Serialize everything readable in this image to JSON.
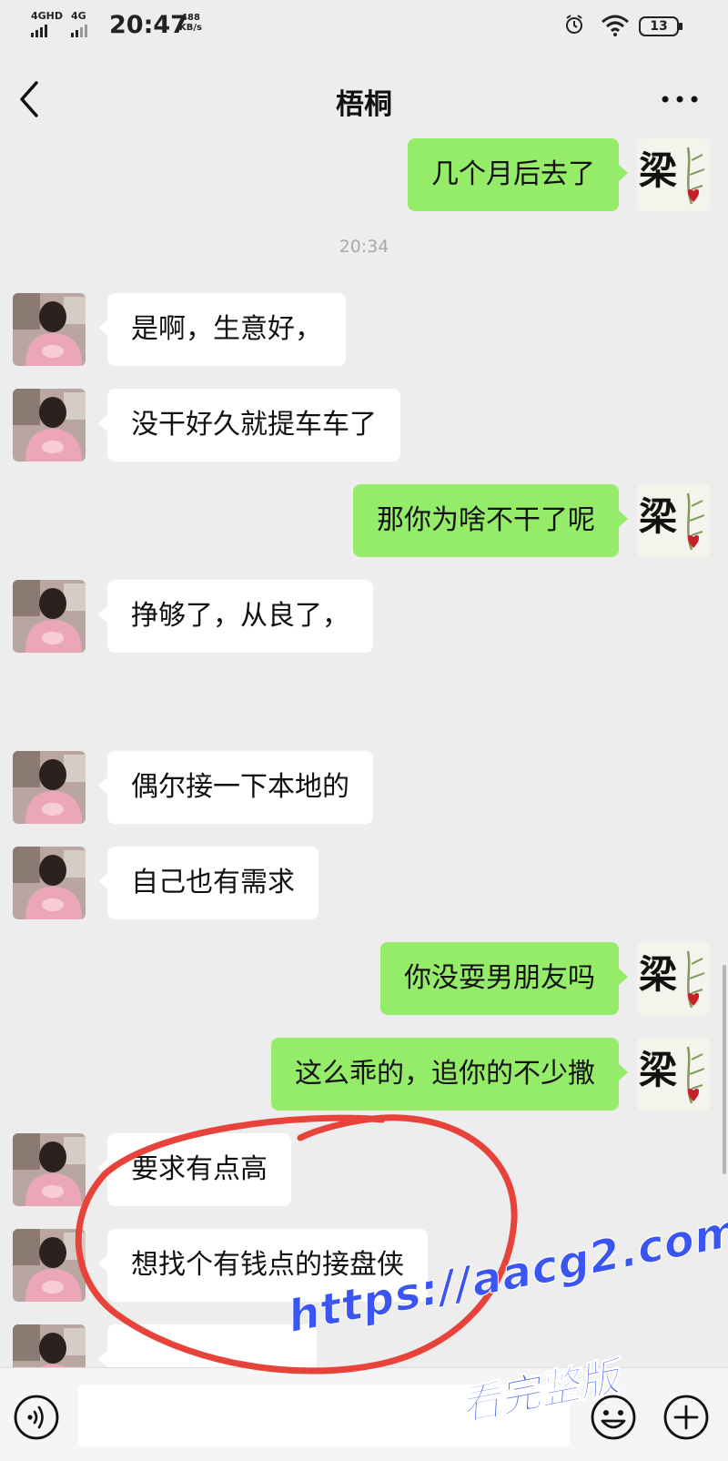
{
  "status_bar": {
    "network1": "4GHD",
    "network2": "4G",
    "time": "20:47",
    "speed_value": "488",
    "speed_unit": "KB/s",
    "battery": "13",
    "icons": [
      "alarm-icon",
      "wifi-icon",
      "battery-icon"
    ]
  },
  "header": {
    "title": "梧桐",
    "back_icon": "chevron-left-icon",
    "more_icon": "more-dots-icon"
  },
  "messages": [
    {
      "sender": "me",
      "text": "几个月后去了"
    },
    {
      "type": "time",
      "text": "20:34"
    },
    {
      "sender": "them",
      "text": "是啊，生意好，"
    },
    {
      "sender": "them",
      "text": "没干好久就提车车了"
    },
    {
      "sender": "me",
      "text": "那你为啥不干了呢"
    },
    {
      "sender": "them",
      "text": "挣够了，从良了，"
    },
    {
      "sender": "them",
      "text": "偶尔接一下本地的"
    },
    {
      "sender": "them",
      "text": "自己也有需求"
    },
    {
      "sender": "me",
      "text": "你没耍男朋友吗"
    },
    {
      "sender": "me",
      "text": "这么乖的，追你的不少撒"
    },
    {
      "sender": "them",
      "text": "要求有点高"
    },
    {
      "sender": "them",
      "text": "想找个有钱点的接盘侠"
    }
  ],
  "my_avatar_glyph": "梁",
  "input_bar": {
    "voice_icon": "voice-icon",
    "emoji_icon": "emoji-icon",
    "plus_icon": "plus-icon"
  },
  "colors": {
    "background": "#ededed",
    "my_bubble": "#95ec69",
    "their_bubble": "#ffffff",
    "annotation": "#e8433b",
    "watermark": "#3b55f2"
  },
  "watermark": {
    "url": "https://aacg2.com",
    "subtitle": "看完整版"
  }
}
